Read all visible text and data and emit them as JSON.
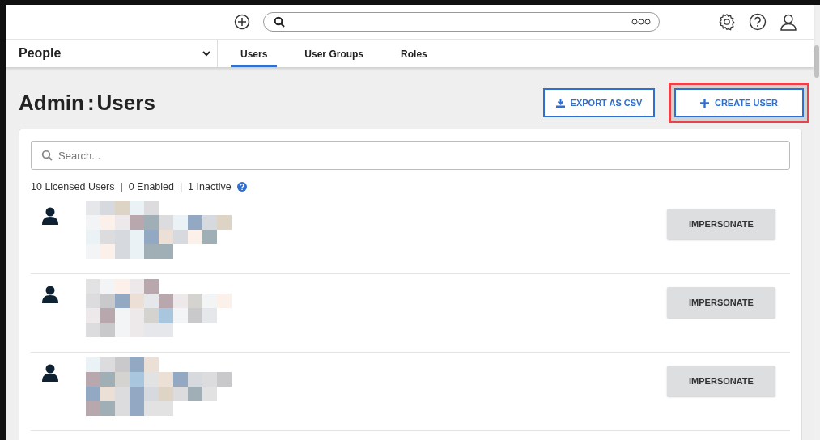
{
  "section_select": {
    "label": "People"
  },
  "tabs": [
    {
      "label": "Users",
      "selected": true
    },
    {
      "label": "User Groups",
      "selected": false
    },
    {
      "label": "Roles",
      "selected": false
    }
  ],
  "page": {
    "title_prefix": "Admin",
    "title_separator": ":",
    "title": "Users"
  },
  "actions": [
    {
      "label": "EXPORT AS CSV",
      "kind": "export",
      "highlighted": false
    },
    {
      "label": "CREATE USER",
      "kind": "create",
      "highlighted": true
    }
  ],
  "search": {
    "placeholder": "Search..."
  },
  "summary": {
    "text": "10 Licensed Users  |  0 Enabled  |  1 Inactive"
  },
  "users": [
    {
      "button": "IMPERSONATE"
    },
    {
      "button": "IMPERSONATE"
    },
    {
      "button": "IMPERSONATE"
    }
  ]
}
